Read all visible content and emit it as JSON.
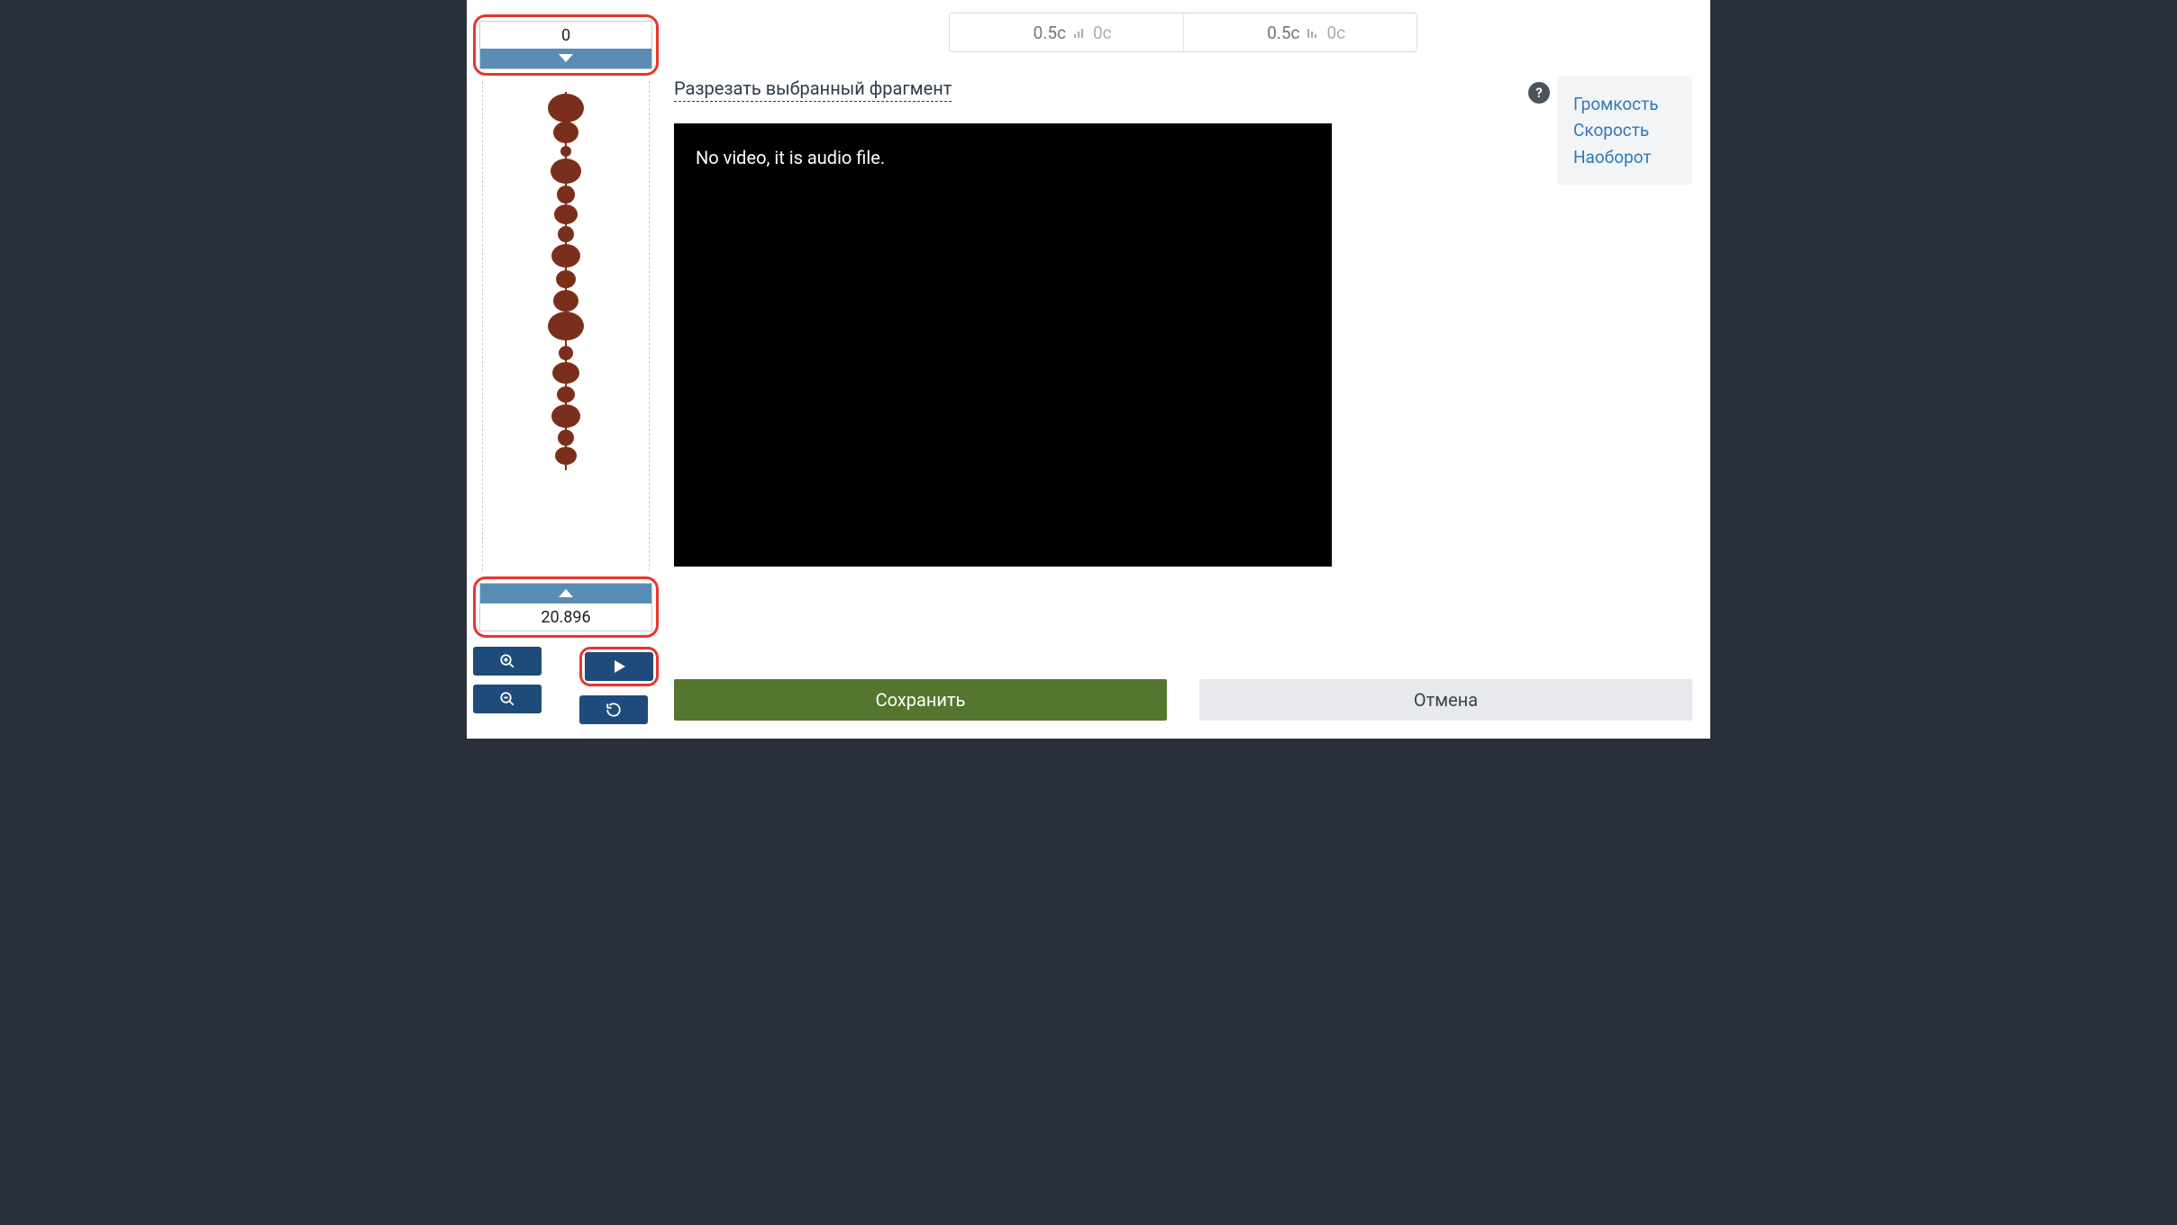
{
  "markers": {
    "start": "0",
    "end": "20.896"
  },
  "topInputs": {
    "fadeInDefault": "0.5с",
    "fadeInLabel": "0с",
    "fadeOutDefault": "0.5с",
    "fadeOutLabel": "0с"
  },
  "cutLink": "Разрезать выбранный фрагмент",
  "videoMsg": "No video, it is audio file.",
  "side": {
    "volume": "Громкость",
    "speed": "Скорость",
    "reverse": "Наоборот"
  },
  "buttons": {
    "save": "Сохранить",
    "cancel": "Отмена"
  },
  "help": "?"
}
